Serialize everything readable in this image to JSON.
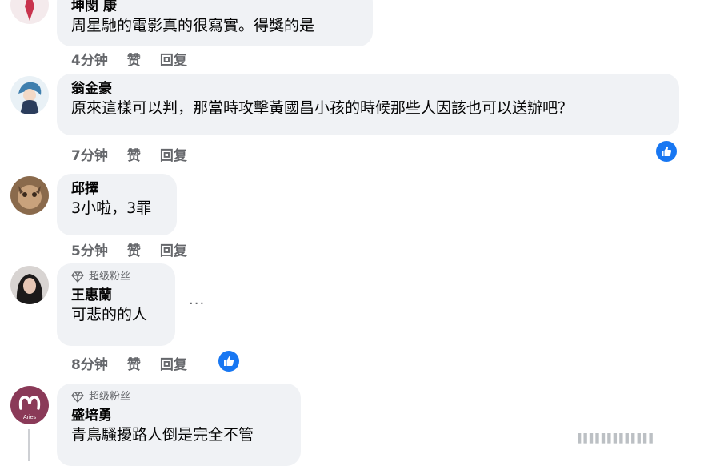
{
  "actions": {
    "like_label": "赞",
    "reply_label": "回复"
  },
  "super_fan_label": "超级粉丝",
  "comments": [
    {
      "name": "坤閔 康",
      "text": "周星馳的電影真的很寫實。得獎的是",
      "time": "4分钟"
    },
    {
      "name": "翁金豪",
      "text": "原來這樣可以判，那當時攻擊黃國昌小孩的時候那些人因該也可以送辦吧？",
      "time": "7分钟"
    },
    {
      "name": "邱擇",
      "text": "3小啦，3罪",
      "time": "5分钟"
    },
    {
      "name": "王惠蘭",
      "text": "可悲的的人",
      "time": "8分钟"
    },
    {
      "name": "盛培勇",
      "text": "青鳥騷擾路人倒是完全不管"
    }
  ],
  "avatar_logo_text": "Aries",
  "more_button": "···",
  "watermark": "▌▌▌▌▌▌▌▌▌▌▌▌▌",
  "colors": {
    "bubble": "#f0f2f5",
    "meta": "#65676b",
    "like_blue": "#1877f2"
  }
}
